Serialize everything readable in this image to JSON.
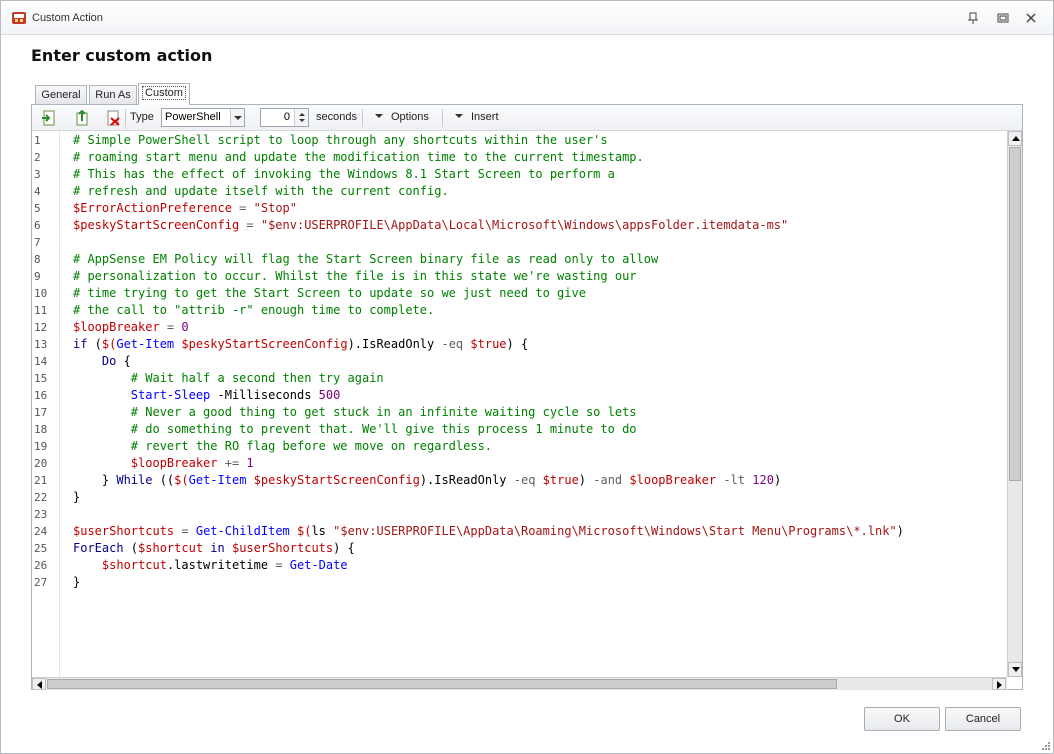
{
  "window": {
    "title": "Custom Action",
    "heading": "Enter custom action"
  },
  "tabs": [
    {
      "label": "General",
      "active": false
    },
    {
      "label": "Run As",
      "active": false
    },
    {
      "label": "Custom",
      "active": true
    }
  ],
  "toolbar": {
    "type_label": "Type",
    "type_value": "PowerShell",
    "timeout_value": "0",
    "timeout_unit": "seconds",
    "options_label": "Options",
    "insert_label": "Insert"
  },
  "editor": {
    "lines": [
      {
        "n": "1",
        "tokens": [
          {
            "t": "# Simple PowerShell script to loop through any shortcuts within the user's",
            "c": "comment"
          }
        ]
      },
      {
        "n": "2",
        "tokens": [
          {
            "t": "# roaming start menu and update the modification time to the current timestamp.",
            "c": "comment"
          }
        ]
      },
      {
        "n": "3",
        "tokens": [
          {
            "t": "# This has the effect of invoking the Windows 8.1 Start Screen to perform a",
            "c": "comment"
          }
        ]
      },
      {
        "n": "4",
        "tokens": [
          {
            "t": "# refresh and update itself with the current config.",
            "c": "comment"
          }
        ]
      },
      {
        "n": "5",
        "tokens": [
          {
            "t": "$ErrorActionPreference",
            "c": "var"
          },
          {
            "t": " = ",
            "c": "op"
          },
          {
            "t": "\"Stop\"",
            "c": "str"
          }
        ]
      },
      {
        "n": "6",
        "tokens": [
          {
            "t": "$peskyStartScreenConfig",
            "c": "var"
          },
          {
            "t": " = ",
            "c": "op"
          },
          {
            "t": "\"$env:USERPROFILE\\AppData\\Local\\Microsoft\\Windows\\appsFolder.itemdata-ms\"",
            "c": "str"
          }
        ]
      },
      {
        "n": "7",
        "tokens": []
      },
      {
        "n": "8",
        "tokens": [
          {
            "t": "# AppSense EM Policy will flag the Start Screen binary file as read only to allow",
            "c": "comment"
          }
        ]
      },
      {
        "n": "9",
        "tokens": [
          {
            "t": "# personalization to occur. Whilst the file is in this state we're wasting our",
            "c": "comment"
          }
        ]
      },
      {
        "n": "10",
        "tokens": [
          {
            "t": "# time trying to get the Start Screen to update so we just need to give",
            "c": "comment"
          }
        ]
      },
      {
        "n": "11",
        "tokens": [
          {
            "t": "# the call to \"attrib -r\" enough time to complete.",
            "c": "comment"
          }
        ]
      },
      {
        "n": "12",
        "tokens": [
          {
            "t": "$loopBreaker",
            "c": "var"
          },
          {
            "t": " = ",
            "c": "op"
          },
          {
            "t": "0",
            "c": "num"
          }
        ]
      },
      {
        "n": "13",
        "tokens": [
          {
            "t": "if",
            "c": "kw"
          },
          {
            "t": " (",
            "c": "plain"
          },
          {
            "t": "$(",
            "c": "var"
          },
          {
            "t": "Get-Item",
            "c": "cmd"
          },
          {
            "t": " ",
            "c": "plain"
          },
          {
            "t": "$peskyStartScreenConfig",
            "c": "var"
          },
          {
            "t": ").IsReadOnly ",
            "c": "plain"
          },
          {
            "t": "-eq",
            "c": "op"
          },
          {
            "t": " ",
            "c": "plain"
          },
          {
            "t": "$true",
            "c": "var"
          },
          {
            "t": ") {",
            "c": "plain"
          }
        ]
      },
      {
        "n": "14",
        "tokens": [
          {
            "t": "    ",
            "c": "plain"
          },
          {
            "t": "Do",
            "c": "kw"
          },
          {
            "t": " {",
            "c": "plain"
          }
        ]
      },
      {
        "n": "15",
        "tokens": [
          {
            "t": "        ",
            "c": "plain"
          },
          {
            "t": "# Wait half a second then try again",
            "c": "comment"
          }
        ]
      },
      {
        "n": "16",
        "tokens": [
          {
            "t": "        ",
            "c": "plain"
          },
          {
            "t": "Start-Sleep",
            "c": "cmd"
          },
          {
            "t": " -Milliseconds ",
            "c": "plain"
          },
          {
            "t": "500",
            "c": "num"
          }
        ]
      },
      {
        "n": "17",
        "tokens": [
          {
            "t": "        ",
            "c": "plain"
          },
          {
            "t": "# Never a good thing to get stuck in an infinite waiting cycle so lets",
            "c": "comment"
          }
        ]
      },
      {
        "n": "18",
        "tokens": [
          {
            "t": "        ",
            "c": "plain"
          },
          {
            "t": "# do something to prevent that. We'll give this process 1 minute to do",
            "c": "comment"
          }
        ]
      },
      {
        "n": "19",
        "tokens": [
          {
            "t": "        ",
            "c": "plain"
          },
          {
            "t": "# revert the RO flag before we move on regardless.",
            "c": "comment"
          }
        ]
      },
      {
        "n": "20",
        "tokens": [
          {
            "t": "        ",
            "c": "plain"
          },
          {
            "t": "$loopBreaker",
            "c": "var"
          },
          {
            "t": " += ",
            "c": "op"
          },
          {
            "t": "1",
            "c": "num"
          }
        ]
      },
      {
        "n": "21",
        "tokens": [
          {
            "t": "    } ",
            "c": "plain"
          },
          {
            "t": "While",
            "c": "kw"
          },
          {
            "t": " ((",
            "c": "plain"
          },
          {
            "t": "$(",
            "c": "var"
          },
          {
            "t": "Get-Item",
            "c": "cmd"
          },
          {
            "t": " ",
            "c": "plain"
          },
          {
            "t": "$peskyStartScreenConfig",
            "c": "var"
          },
          {
            "t": ").IsReadOnly ",
            "c": "plain"
          },
          {
            "t": "-eq",
            "c": "op"
          },
          {
            "t": " ",
            "c": "plain"
          },
          {
            "t": "$true",
            "c": "var"
          },
          {
            "t": ") ",
            "c": "plain"
          },
          {
            "t": "-and",
            "c": "op"
          },
          {
            "t": " ",
            "c": "plain"
          },
          {
            "t": "$loopBreaker",
            "c": "var"
          },
          {
            "t": " ",
            "c": "plain"
          },
          {
            "t": "-lt",
            "c": "op"
          },
          {
            "t": " ",
            "c": "plain"
          },
          {
            "t": "120",
            "c": "num"
          },
          {
            "t": ")",
            "c": "plain"
          }
        ]
      },
      {
        "n": "22",
        "tokens": [
          {
            "t": "}",
            "c": "plain"
          }
        ]
      },
      {
        "n": "23",
        "tokens": []
      },
      {
        "n": "24",
        "tokens": [
          {
            "t": "$userShortcuts",
            "c": "var"
          },
          {
            "t": " = ",
            "c": "op"
          },
          {
            "t": "Get-ChildItem",
            "c": "cmd"
          },
          {
            "t": " ",
            "c": "plain"
          },
          {
            "t": "$(",
            "c": "var"
          },
          {
            "t": "ls ",
            "c": "plain"
          },
          {
            "t": "\"$env:USERPROFILE\\AppData\\Roaming\\Microsoft\\Windows\\Start Menu\\Programs\\*.lnk\"",
            "c": "str"
          },
          {
            "t": ")",
            "c": "plain"
          }
        ]
      },
      {
        "n": "25",
        "tokens": [
          {
            "t": "ForEach",
            "c": "kw"
          },
          {
            "t": " (",
            "c": "plain"
          },
          {
            "t": "$shortcut",
            "c": "var"
          },
          {
            "t": " ",
            "c": "plain"
          },
          {
            "t": "in",
            "c": "kw"
          },
          {
            "t": " ",
            "c": "plain"
          },
          {
            "t": "$userShortcuts",
            "c": "var"
          },
          {
            "t": ") {",
            "c": "plain"
          }
        ]
      },
      {
        "n": "26",
        "tokens": [
          {
            "t": "    ",
            "c": "plain"
          },
          {
            "t": "$shortcut",
            "c": "var"
          },
          {
            "t": ".lastwritetime ",
            "c": "plain"
          },
          {
            "t": "=",
            "c": "op"
          },
          {
            "t": " ",
            "c": "plain"
          },
          {
            "t": "Get-Date",
            "c": "cmd"
          }
        ]
      },
      {
        "n": "27",
        "tokens": [
          {
            "t": "}",
            "c": "plain"
          }
        ]
      }
    ]
  },
  "buttons": {
    "ok_label": "OK",
    "cancel_label": "Cancel"
  },
  "icons": {
    "title": "app-icon",
    "import": "import-icon",
    "export": "export-icon",
    "clear": "clear-icon"
  },
  "colors": {
    "comment": "#008000",
    "variable": "#c00000",
    "string": "#a31515",
    "keyword": "#00008b",
    "cmdlet": "#0000ff",
    "number": "#800080"
  }
}
